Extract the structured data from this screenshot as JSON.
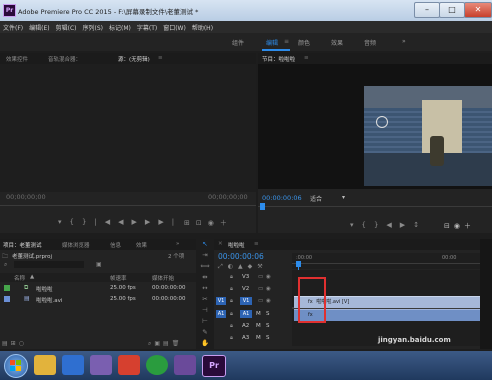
{
  "window": {
    "title": "Adobe Premiere Pro CC 2015 - F:\\屏幕录制文件\\老董测试 *",
    "logo": "Pr",
    "minimize_glyph": "–",
    "maximize_glyph": "□",
    "close_glyph": "✕"
  },
  "menu": [
    "文件(F)",
    "编辑(E)",
    "剪辑(C)",
    "序列(S)",
    "标记(M)",
    "字幕(T)",
    "窗口(W)",
    "帮助(H)"
  ],
  "workspaces": {
    "items": [
      "组件",
      "编辑",
      "颜色",
      "效果",
      "音频"
    ],
    "active": "编辑",
    "overflow": "»"
  },
  "source_panel": {
    "tabs": [
      "效果控件",
      "音轨混合器：",
      "源：(无剪辑)"
    ],
    "timecode_left": "00;00;00;00",
    "timecode_right": "00;00;00;00"
  },
  "program_panel": {
    "tab": "节目：啦啦啦",
    "menu_glyph": "≡",
    "timecode": "00:00:00:06",
    "fit": "适合",
    "fit_caret": "▾"
  },
  "project_panel": {
    "tabs": [
      "项目：老董测试",
      "媒体浏览器",
      "信息",
      "效果"
    ],
    "overflow": "»",
    "file_name": "老董测试.prproj",
    "item_count": "2 个项",
    "columns": [
      "名称",
      "帧速率",
      "媒体开始"
    ],
    "items": [
      {
        "name": "啦啦啦",
        "fps": "25.00 fps",
        "start": "00:00:00:00",
        "color": "#46a64b"
      },
      {
        "name": "啦啦啦.avi",
        "fps": "25.00 fps",
        "start": "00:00:00:00",
        "color": "#6b8fd6"
      }
    ]
  },
  "timeline": {
    "tab": "啦啦啦",
    "timecode": "00:00:00:06",
    "ruler": [
      ":00:00",
      "00:00"
    ],
    "video_tracks": [
      {
        "label": "V3",
        "patch": ""
      },
      {
        "label": "V2",
        "patch": ""
      },
      {
        "label": "V1",
        "patch": "V1"
      }
    ],
    "audio_tracks": [
      {
        "label": "A1",
        "patch": "A1"
      },
      {
        "label": "A2",
        "patch": ""
      },
      {
        "label": "A3",
        "patch": ""
      }
    ],
    "video_clip": "啦啦啦.avi [V]",
    "m_label": "M",
    "s_label": "S"
  },
  "colors": {
    "accent": "#2d8ceb",
    "highlight_box": "#e03030",
    "clip_video": "#a6b8d8",
    "clip_audio": "#6f8fc5"
  },
  "watermark": "jingyan.baidu.com"
}
